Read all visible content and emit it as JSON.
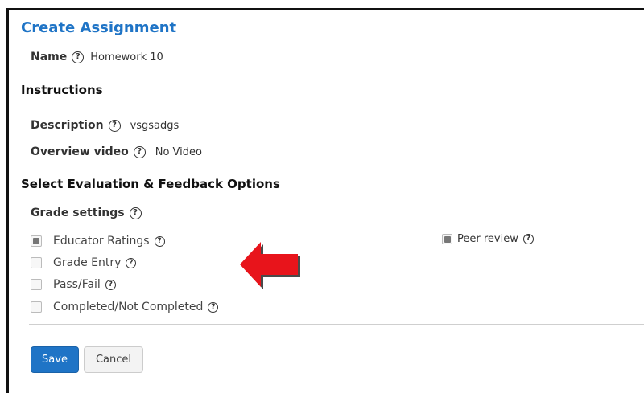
{
  "page": {
    "title": "Create Assignment"
  },
  "name_field": {
    "label": "Name",
    "value": "Homework 10"
  },
  "instructions": {
    "heading": "Instructions",
    "description_label": "Description",
    "description_value": "vsgsadgs",
    "video_label": "Overview video",
    "video_value": "No Video"
  },
  "evaluation": {
    "heading": "Select Evaluation & Feedback Options",
    "grade_settings_label": "Grade settings",
    "options": [
      {
        "label": "Educator Ratings",
        "checked": true
      },
      {
        "label": "Grade Entry",
        "checked": false
      },
      {
        "label": "Pass/Fail",
        "checked": false
      },
      {
        "label": "Completed/Not Completed",
        "checked": false
      }
    ],
    "peer_review": {
      "label": "Peer review",
      "checked": true
    }
  },
  "actions": {
    "save_label": "Save",
    "cancel_label": "Cancel"
  },
  "colors": {
    "accent": "#1f74c6",
    "arrow": "#e8141b"
  },
  "icons": {
    "help": "help-circle-icon",
    "annotation": "red-arrow-left-icon"
  }
}
